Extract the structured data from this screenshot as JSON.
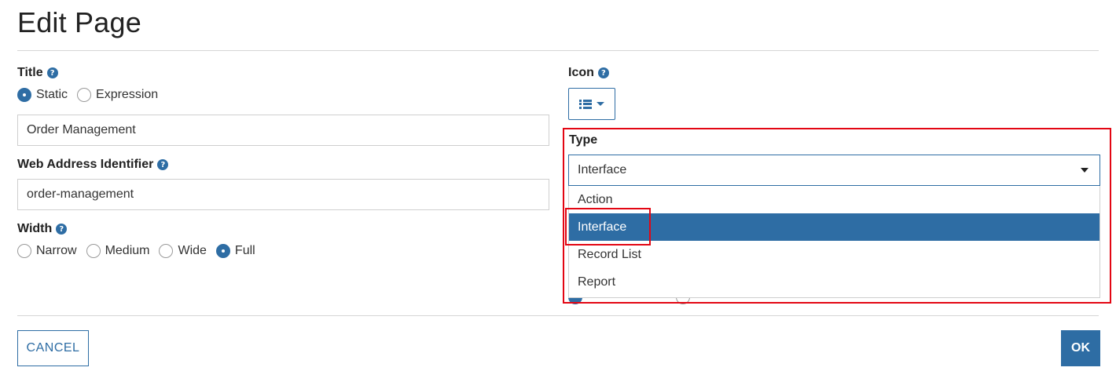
{
  "page": {
    "title": "Edit Page"
  },
  "title_field": {
    "label": "Title",
    "help_icon": "question-circle-icon",
    "modes": [
      {
        "label": "Static",
        "checked": true
      },
      {
        "label": "Expression",
        "checked": false
      }
    ],
    "value": "Order Management"
  },
  "web_address": {
    "label": "Web Address Identifier",
    "help_icon": "question-circle-icon",
    "value": "order-management"
  },
  "width_field": {
    "label": "Width",
    "help_icon": "question-circle-icon",
    "options": [
      {
        "label": "Narrow",
        "checked": false
      },
      {
        "label": "Medium",
        "checked": false
      },
      {
        "label": "Wide",
        "checked": false
      },
      {
        "label": "Full",
        "checked": true
      }
    ]
  },
  "icon_field": {
    "label": "Icon",
    "help_icon": "question-circle-icon",
    "selected_icon": "list-icon"
  },
  "type_field": {
    "label": "Type",
    "value": "Interface",
    "options": [
      {
        "label": "Action",
        "selected": false
      },
      {
        "label": "Interface",
        "selected": true
      },
      {
        "label": "Record List",
        "selected": false
      },
      {
        "label": "Report",
        "selected": false
      }
    ]
  },
  "buttons": {
    "cancel": "CANCEL",
    "ok": "OK"
  },
  "colors": {
    "accent": "#2e6da4",
    "highlight": "#e30613",
    "divider": "#d6d6d6"
  }
}
